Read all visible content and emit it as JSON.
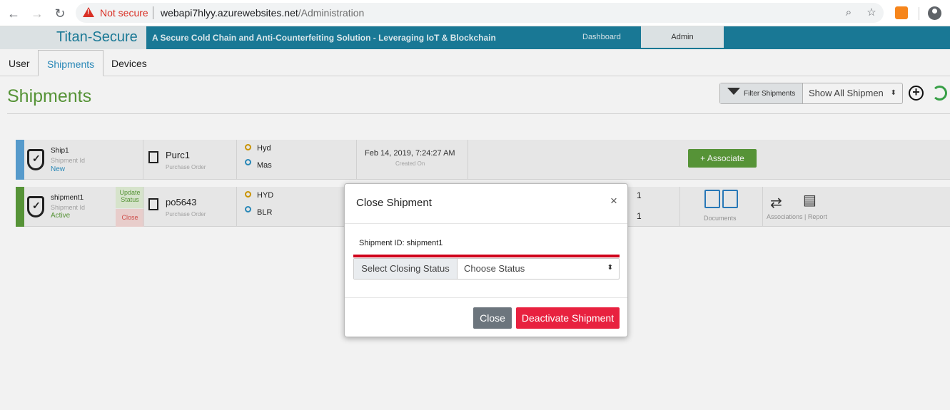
{
  "browser": {
    "not_secure": "Not secure",
    "url_host": "webapi7hlyy.azurewebsites.net",
    "url_path": "/Administration"
  },
  "header": {
    "brand": "Titan-Secure",
    "tagline": "A Secure Cold Chain and Anti-Counterfeiting Solution - Leveraging IoT & Blockchain",
    "dashboard": "Dashboard",
    "admin": "Admin"
  },
  "tabs": [
    {
      "label": "User"
    },
    {
      "label": "Shipments"
    },
    {
      "label": "Devices"
    }
  ],
  "page": {
    "title": "Shipments",
    "filter_label": "Filter Shipments",
    "filter_value": "Show All Shipmen"
  },
  "shipments": [
    {
      "name": "Ship1",
      "id_label": "Shipment Id",
      "status": "New",
      "po": "Purc1",
      "po_label": "Purchase Order",
      "from": "Hyd",
      "to": "Mas",
      "date": "Feb 14, 2019, 7:24:27 AM",
      "date_label": "Created On",
      "action": "+ Associate"
    },
    {
      "name": "shipment1",
      "id_label": "Shipment Id",
      "status": "Active",
      "update_status": "Update Status",
      "close": "Close",
      "po": "po5643",
      "po_label": "Purchase Order",
      "from": "HYD",
      "to": "BLR",
      "num1": "1",
      "num2": "1",
      "docs_label": "Documents",
      "assoc_label": "Associations | Report"
    }
  ],
  "modal": {
    "title": "Close Shipment",
    "close_x": "×",
    "shipment_id": "Shipment ID: shipment1",
    "status_label": "Select Closing Status",
    "status_value": "Choose Status",
    "close_button": "Close",
    "deactivate_button": "Deactivate Shipment"
  },
  "colors": {
    "header": "#1b7f9d",
    "accent_green": "#5b9b3a",
    "danger": "#e8213f"
  }
}
